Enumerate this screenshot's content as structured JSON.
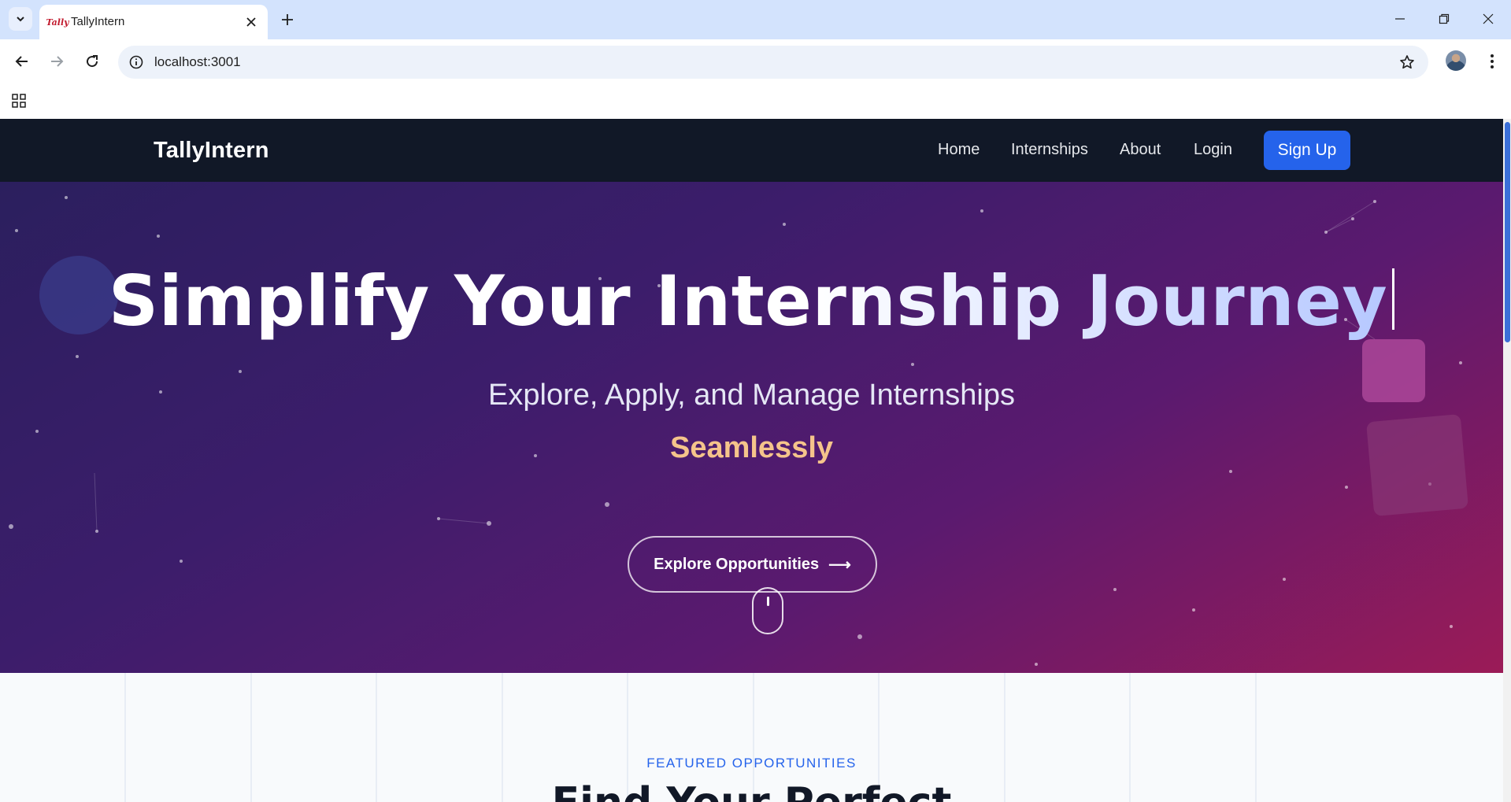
{
  "browser": {
    "tab_title": "TallyIntern",
    "favicon_text": "Tally",
    "url": "localhost:3001"
  },
  "site": {
    "brand": "TallyIntern",
    "nav": {
      "home": "Home",
      "internships": "Internships",
      "about": "About",
      "login": "Login",
      "signup": "Sign Up"
    }
  },
  "hero": {
    "headline": "Simplify Your Internship Journey",
    "subline": "Explore, Apply, and Manage Internships",
    "accent": "Seamlessly",
    "cta_label": "Explore Opportunities",
    "cta_arrow": "⟶"
  },
  "featured": {
    "eyebrow": "FEATURED OPPORTUNITIES",
    "title": "Find Your Perfect"
  },
  "colors": {
    "nav_bg": "#111827",
    "signup_bg": "#2563eb",
    "accent": "#f5c48b",
    "eyebrow": "#2563eb"
  }
}
